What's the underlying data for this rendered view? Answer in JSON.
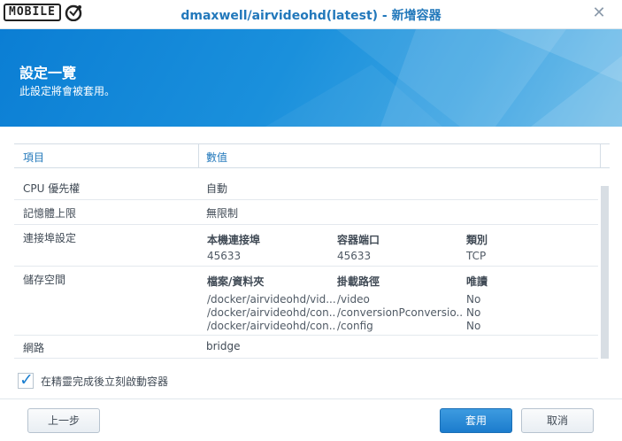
{
  "window": {
    "logo_text": "MOBILE",
    "title": "dmaxwell/airvideohd(latest) - 新增容器",
    "close_icon": "close-icon"
  },
  "banner": {
    "title": "設定一覽",
    "subtitle": "此設定將會被套用。"
  },
  "table": {
    "headers": [
      "項目",
      "數值"
    ],
    "rows": {
      "cpu": {
        "key": "CPU 優先權",
        "value": "自動"
      },
      "memory": {
        "key": "記憶體上限",
        "value": "無限制"
      },
      "port": {
        "key": "連接埠設定",
        "headers": [
          "本機連接埠",
          "容器端口",
          "類別"
        ],
        "values": [
          "45633",
          "45633",
          "TCP"
        ]
      },
      "storage": {
        "key": "儲存空間",
        "headers": [
          "檔案/資料夾",
          "掛載路徑",
          "唯讀"
        ],
        "entries": [
          [
            "/docker/airvideohd/vid...",
            "/video",
            "No"
          ],
          [
            "/docker/airvideohd/con...",
            "/conversionPconversio...",
            "No"
          ],
          [
            "/docker/airvideohd/con...",
            "/config",
            "No"
          ]
        ]
      },
      "network": {
        "key": "網路",
        "value": "bridge"
      }
    }
  },
  "options": {
    "run_after_label": "在精靈完成後立刻啟動容器",
    "run_after_checked": true
  },
  "footer": {
    "back_label": "上一步",
    "apply_label": "套用",
    "cancel_label": "取消"
  },
  "colors": {
    "accent": "#2278bb",
    "banner": "#0b7ed4",
    "primary_button": "#1c7ccd"
  }
}
